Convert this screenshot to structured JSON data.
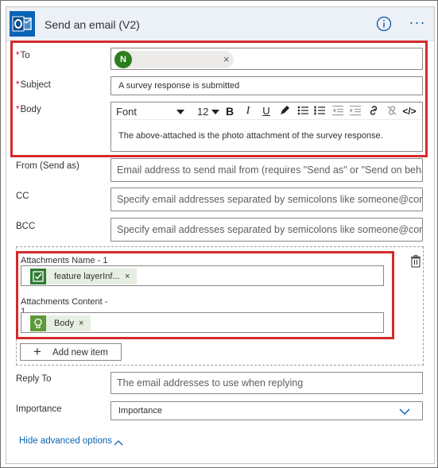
{
  "header": {
    "title": "Send an email (V2)",
    "info_icon": "info-icon",
    "more_icon": "more-options-icon",
    "more_glyph": "···"
  },
  "colors": {
    "accent": "#0a64b4",
    "required": "#c50f1f",
    "highlight": "#d52a2a",
    "avatar": "#2d7d1f",
    "token_bg": "#e6efe2"
  },
  "fields": {
    "to": {
      "label": "To",
      "required_mark": "*",
      "chip_initial": "N",
      "chip_remove": "×"
    },
    "subject": {
      "label": "Subject",
      "required_mark": "*",
      "value": "A survey response is submitted"
    },
    "body": {
      "label": "Body",
      "required_mark": "*",
      "font": "Font",
      "font_size": "12",
      "bold": "B",
      "italic": "I",
      "underline": "U",
      "code_glyph": "</>",
      "text": "The above-attached is the photo attachment of the survey response."
    },
    "from": {
      "label": "From (Send as)",
      "placeholder": "Email address to send mail from (requires \"Send as\" or \"Send on behalf of\" permission)"
    },
    "cc": {
      "label": "CC",
      "placeholder": "Specify email addresses separated by semicolons like someone@contoso.com"
    },
    "bcc": {
      "label": "BCC",
      "placeholder": "Specify email addresses separated by semicolons like someone@contoso.com"
    },
    "attachments": {
      "name_label": "Attachments Name - 1",
      "name_token": "feature layerInf...",
      "name_token_remove": "×",
      "content_label_line1": "Attachments Content -",
      "content_label_line2": "1",
      "content_token": "Body",
      "content_token_remove": "×",
      "add_item": "Add new item",
      "add_glyph": "+"
    },
    "reply_to": {
      "label": "Reply To",
      "placeholder": "The email addresses to use when replying"
    },
    "importance": {
      "label": "Importance",
      "value": "Importance"
    }
  },
  "footer": {
    "hide_advanced": "Hide advanced options"
  }
}
